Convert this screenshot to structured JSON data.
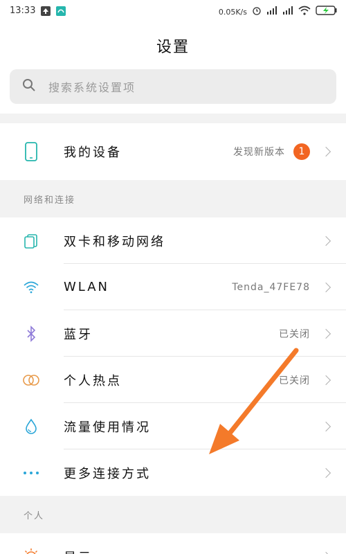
{
  "status_bar": {
    "time": "13:33",
    "speed": "0.05K/s",
    "battery_icon": "battery-charging-icon"
  },
  "header": {
    "title": "设置"
  },
  "search": {
    "placeholder": "搜索系统设置项"
  },
  "device_row": {
    "label": "我的设备",
    "value": "发现新版本",
    "badge": "1"
  },
  "network_section": {
    "title": "网络和连接",
    "items": [
      {
        "label": "双卡和移动网络",
        "value": "",
        "icon": "sim-cards-icon"
      },
      {
        "label": "WLAN",
        "value": "Tenda_47FE78",
        "icon": "wifi-icon"
      },
      {
        "label": "蓝牙",
        "value": "已关闭",
        "icon": "bluetooth-icon"
      },
      {
        "label": "个人热点",
        "value": "已关闭",
        "icon": "hotspot-icon"
      },
      {
        "label": "流量使用情况",
        "value": "",
        "icon": "data-usage-icon"
      },
      {
        "label": "更多连接方式",
        "value": "",
        "icon": "more-dots-icon"
      }
    ]
  },
  "personal_section": {
    "title": "个人",
    "items": [
      {
        "label": "显示",
        "icon": "display-sun-icon"
      }
    ]
  },
  "colors": {
    "accent_teal": "#26b6ad",
    "badge_orange": "#f26522",
    "arrow_orange": "#f47a2a",
    "bluetooth_purple": "#8e7ad8",
    "hotspot_orange": "#e89a4a",
    "wifi_blue": "#2aa6d8"
  }
}
